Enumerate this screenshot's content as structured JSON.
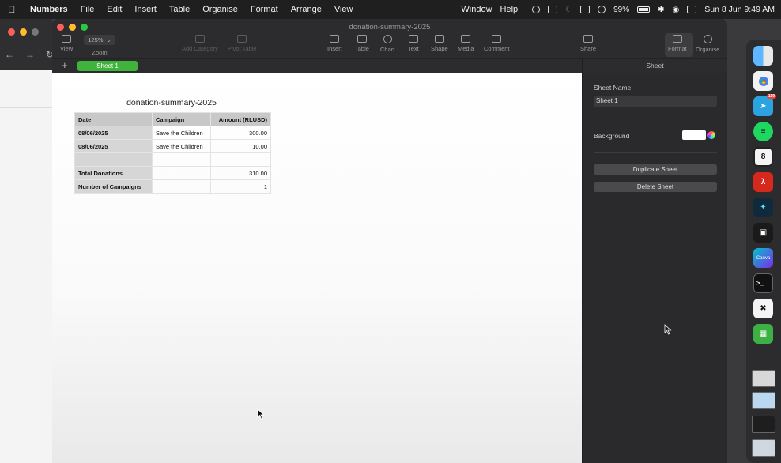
{
  "menubar": {
    "app_name": "Numbers",
    "menus": [
      "File",
      "Edit",
      "Insert",
      "Table",
      "Organise",
      "Format",
      "Arrange",
      "View"
    ],
    "right_menus": [
      "Window",
      "Help"
    ],
    "battery": "99%",
    "datetime": "Sun 8 Jun  9:49 AM"
  },
  "window": {
    "title": "donation-summary-2025",
    "zoom": "125%",
    "toolbar": {
      "view": "View",
      "zoom": "Zoom",
      "add_category": "Add Category",
      "pivot_table": "Pivot Table",
      "insert": "Insert",
      "table": "Table",
      "chart": "Chart",
      "text": "Text",
      "shape": "Shape",
      "media": "Media",
      "comment": "Comment",
      "share": "Share",
      "format": "Format",
      "organise": "Organise"
    },
    "add_sheet": "+",
    "sheet_tab": "Sheet 1"
  },
  "sheet": {
    "table_title": "donation-summary-2025",
    "columns": [
      "Date",
      "Campaign",
      "Amount (RLUSD)"
    ],
    "rows": [
      [
        "08/06/2025",
        "Save the Children",
        "300.00"
      ],
      [
        "08/06/2025",
        "Save the Children",
        "10.00"
      ],
      [
        "",
        "",
        ""
      ],
      [
        "Total Donations",
        "",
        "310.00"
      ],
      [
        "Number of Campaigns",
        "",
        "1"
      ]
    ]
  },
  "inspector": {
    "header": "Sheet",
    "sheet_name_label": "Sheet Name",
    "sheet_name_value": "Sheet 1",
    "background_label": "Background",
    "background_color": "#ffffff",
    "duplicate_button": "Duplicate Sheet",
    "delete_button": "Delete Sheet"
  },
  "dock": {
    "apps": [
      "finder-icon",
      "chrome-icon",
      "telegram-icon",
      "spotify-icon",
      "calendar-icon",
      "acrobat-icon",
      "app-icon",
      "app-icon",
      "canva-icon",
      "terminal-icon",
      "capcut-icon",
      "numbers-icon"
    ],
    "telegram_badge": "119",
    "calendar_day": "8",
    "canva_label": "Canva"
  },
  "colors": {
    "sheet_tab": "#3fb33c",
    "header_fill": "#c8c8c8",
    "panel_bg": "#2a2a2c"
  }
}
